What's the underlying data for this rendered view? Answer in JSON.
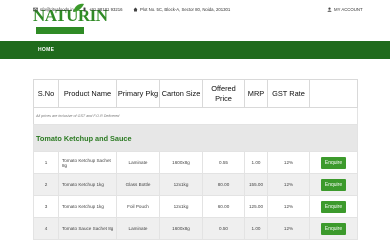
{
  "header": {
    "logo_text": "NATURIN",
    "email": "nfo@rituafoods.in",
    "phone": "+91 98181 93216",
    "address": "Plot No. 5C, Block-A, Sector 80, Noida, 201301",
    "account_label": "MY ACCOUNT"
  },
  "nav": {
    "home_label": "HOME"
  },
  "table": {
    "columns": [
      "S.No",
      "Product Name",
      "Primary Pkg",
      "Carton Size",
      "Offered Price",
      "MRP",
      "GST Rate",
      ""
    ],
    "note": "All prices are inclusive of GST and F.O.R Delivered",
    "category": "Tomato Ketchup and Sauce",
    "rows": [
      {
        "sno": "1",
        "name": "Tomato Ketchup Sachet 8g",
        "pkg": "Laminate",
        "carton": "1600x8g",
        "price": "0.55",
        "mrp": "1.00",
        "gst": "12%",
        "action": "Enquire"
      },
      {
        "sno": "2",
        "name": "Tomato Ketchup 1kg",
        "pkg": "Glass Bottle",
        "carton": "12x1kg",
        "price": "80.00",
        "mrp": "155.00",
        "gst": "12%",
        "action": "Enquire"
      },
      {
        "sno": "3",
        "name": "Tomato Ketchup 1kg",
        "pkg": "Foil Pouch",
        "carton": "12x1kg",
        "price": "60.00",
        "mrp": "125.00",
        "gst": "12%",
        "action": "Enquire"
      },
      {
        "sno": "4",
        "name": "Tomato Sauce Sachet 8g",
        "pkg": "Laminate",
        "carton": "1600x8g",
        "price": "0.50",
        "mrp": "1.00",
        "gst": "12%",
        "action": "Enquire"
      }
    ]
  },
  "colors": {
    "brand_green": "#2f8b25",
    "nav_green": "#1f6b1c",
    "button_green": "#3c9a2c"
  }
}
